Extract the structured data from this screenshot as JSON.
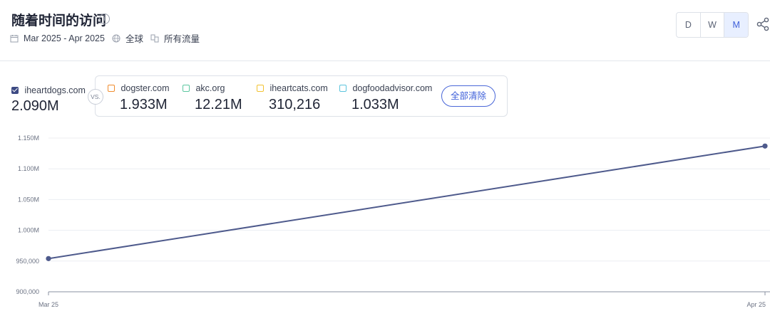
{
  "header": {
    "title": "随着时间的访问",
    "info_icon": "info-icon",
    "date_range": "Mar 2025 - Apr 2025",
    "region": "全球",
    "traffic": "所有流量",
    "granularity": [
      "D",
      "W",
      "M"
    ],
    "active_granularity": "M"
  },
  "main_site": {
    "name": "iheartdogs.com",
    "value": "2.090M",
    "checked": true,
    "color": "#3d4a83"
  },
  "vs_label": "VS.",
  "competitors": [
    {
      "name": "dogster.com",
      "value": "1.933M",
      "color": "#f08c2e"
    },
    {
      "name": "akc.org",
      "value": "12.21M",
      "color": "#5cc7a0"
    },
    {
      "name": "iheartcats.com",
      "value": "310,216",
      "color": "#f2c230"
    },
    {
      "name": "dogfoodadvisor.com",
      "value": "1.033M",
      "color": "#5bc4dd"
    }
  ],
  "clear_all_label": "全部清除",
  "chart_data": {
    "type": "line",
    "x": [
      "Mar 25",
      "Apr 25"
    ],
    "series": [
      {
        "name": "iheartdogs.com",
        "values": [
          954000,
          1137000
        ],
        "color": "#4e5a8c"
      }
    ],
    "yticks": [
      "900,000",
      "950,000",
      "1.000M",
      "1.050M",
      "1.100M",
      "1.150M"
    ],
    "ytick_values": [
      900000,
      950000,
      1000000,
      1050000,
      1100000,
      1150000
    ],
    "ylim": [
      900000,
      1150000
    ],
    "grid": true
  }
}
